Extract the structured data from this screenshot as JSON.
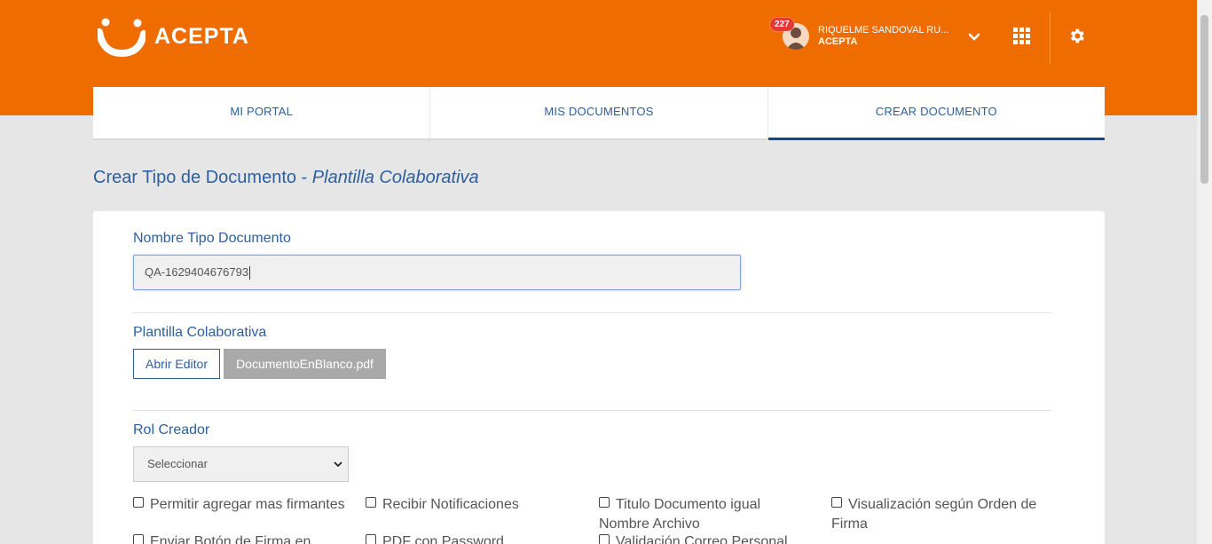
{
  "brand": {
    "name": "ACEPTA",
    "color": "#ef6c00",
    "icon": "acepta-smile-logo"
  },
  "user": {
    "notifications": "227",
    "name": "RIQUELME SANDOVAL RU...",
    "organization": "ACEPTA"
  },
  "header_icons": [
    "chevron-down-icon",
    "apps-grid-icon",
    "gear-icon"
  ],
  "tabs": [
    {
      "label": "MI PORTAL"
    },
    {
      "label": "MIS DOCUMENTOS"
    },
    {
      "label": "CREAR DOCUMENTO",
      "active": true
    }
  ],
  "page": {
    "title": "Crear Tipo de Documento - ",
    "title_italic": "Plantilla Colaborativa"
  },
  "form": {
    "name_label": "Nombre Tipo Documento",
    "name_value": "QA-1629404676793",
    "template_label": "Plantilla Colaborativa",
    "open_editor_label": "Abrir Editor",
    "file_label": "DocumentoEnBlanco.pdf",
    "role_label": "Rol Creador",
    "role_selected": "Seleccionar",
    "options": [
      {
        "label": "Permitir agregar mas firmantes",
        "checked": false
      },
      {
        "label": "Recibir Notificaciones",
        "checked": false
      },
      {
        "label": "Titulo Documento igual Nombre Archivo",
        "checked": false
      },
      {
        "label": "Visualización según Orden de Firma",
        "checked": false
      },
      {
        "label": "Enviar Botón de Firma en",
        "checked": false
      },
      {
        "label": "PDF con Password",
        "checked": false
      },
      {
        "label": "Validación Correo Personal",
        "checked": false
      }
    ]
  },
  "colors": {
    "primary_blue": "#2d5f9e",
    "active_tab": "#0d4a8a",
    "badge": "#e53935"
  }
}
